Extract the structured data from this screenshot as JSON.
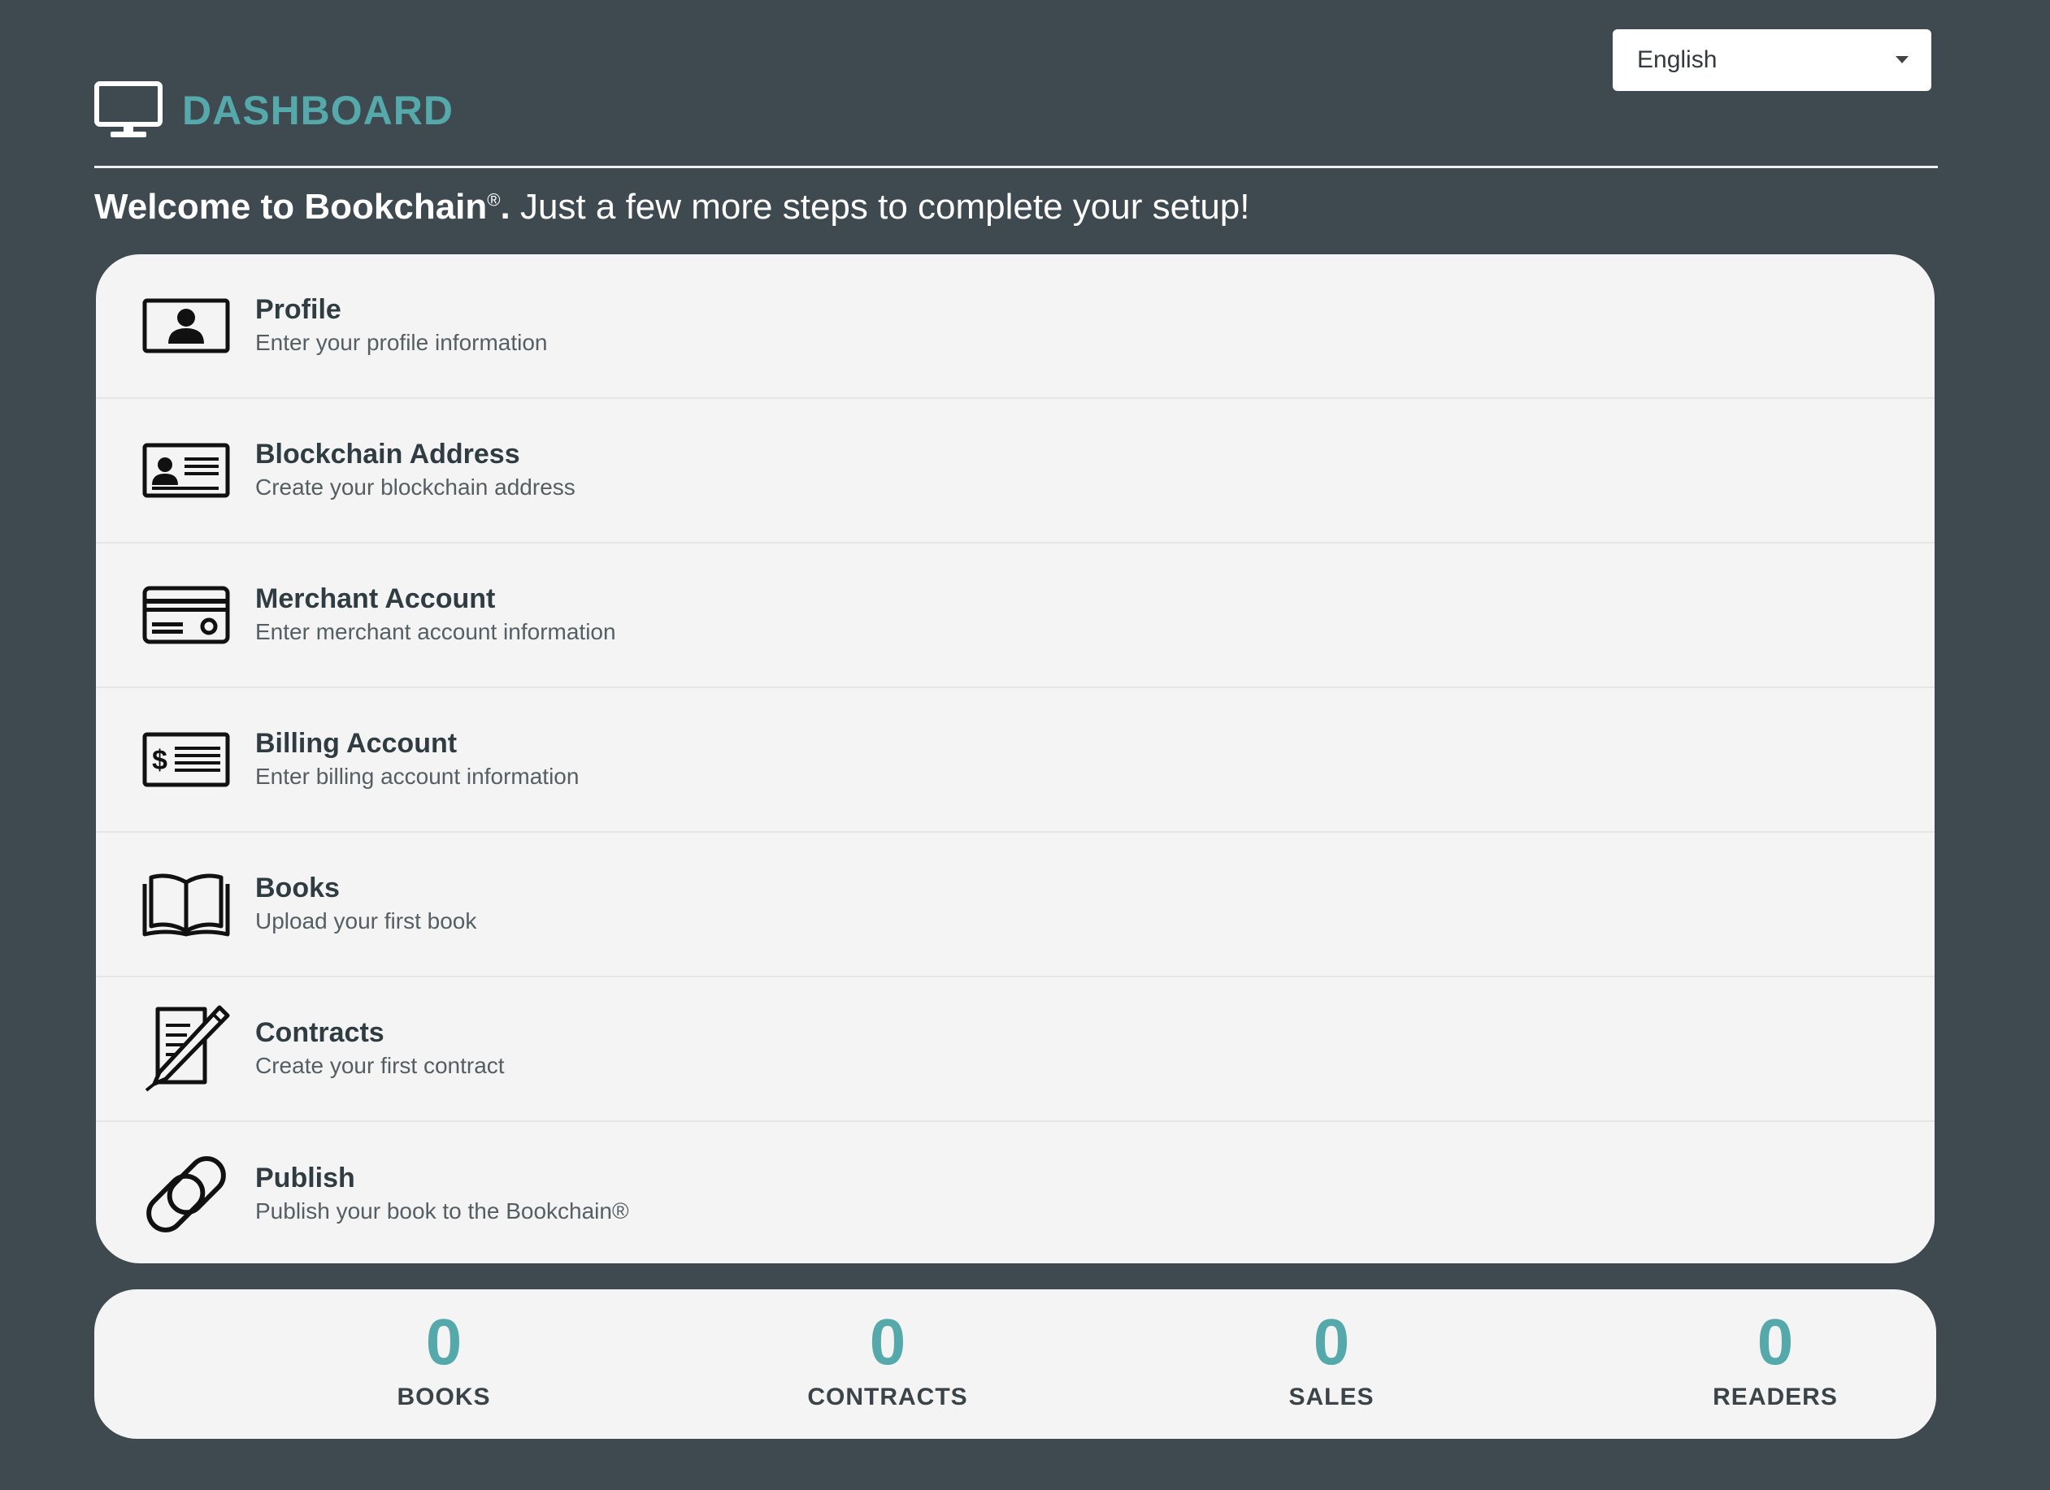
{
  "language_select": {
    "value": "English"
  },
  "header": {
    "icon": "monitor-icon",
    "title": "DASHBOARD"
  },
  "welcome": {
    "brand": "Welcome to Bookchain",
    "registered": "®",
    "period": ".",
    "message": " Just a few more steps to complete your setup!"
  },
  "steps": [
    {
      "icon": "profile-card-icon",
      "title": "Profile",
      "subtitle": "Enter your profile information"
    },
    {
      "icon": "id-card-icon",
      "title": "Blockchain Address",
      "subtitle": "Create your blockchain address"
    },
    {
      "icon": "credit-card-icon",
      "title": "Merchant Account",
      "subtitle": "Enter merchant account information"
    },
    {
      "icon": "billing-check-icon",
      "title": "Billing Account",
      "subtitle": "Enter billing account information"
    },
    {
      "icon": "open-book-icon",
      "title": "Books",
      "subtitle": "Upload your first book"
    },
    {
      "icon": "contract-pen-icon",
      "title": "Contracts",
      "subtitle": "Create your first contract"
    },
    {
      "icon": "chain-link-icon",
      "title": "Publish",
      "subtitle": "Publish your book to the Bookchain®"
    }
  ],
  "stats": [
    {
      "value": "0",
      "label": "BOOKS"
    },
    {
      "value": "0",
      "label": "CONTRACTS"
    },
    {
      "value": "0",
      "label": "SALES"
    },
    {
      "value": "0",
      "label": "READERS"
    }
  ],
  "colors": {
    "background": "#3e4a50",
    "accent": "#55a9aa",
    "card": "#f4f4f4"
  }
}
